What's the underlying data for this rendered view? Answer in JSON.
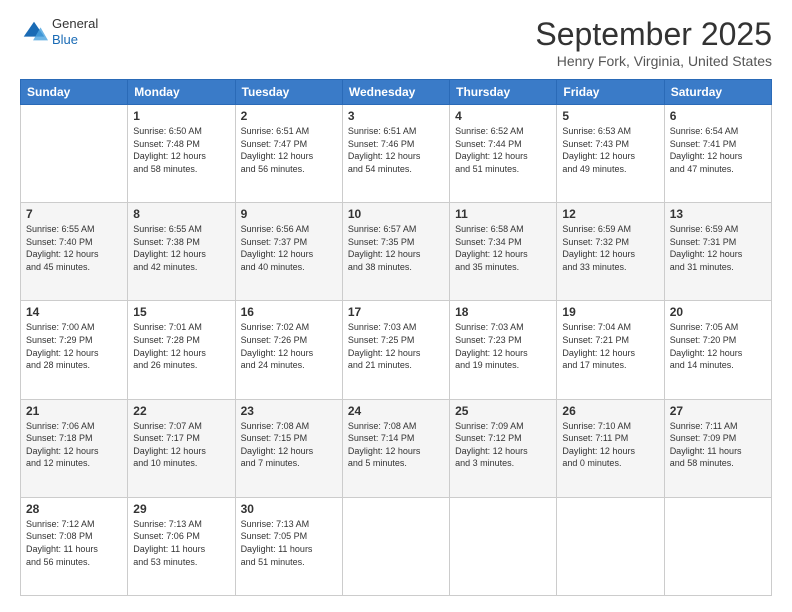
{
  "header": {
    "logo": {
      "general": "General",
      "blue": "Blue"
    },
    "title": "September 2025",
    "location": "Henry Fork, Virginia, United States"
  },
  "calendar": {
    "days_of_week": [
      "Sunday",
      "Monday",
      "Tuesday",
      "Wednesday",
      "Thursday",
      "Friday",
      "Saturday"
    ],
    "weeks": [
      [
        {
          "day": "",
          "content": ""
        },
        {
          "day": "1",
          "content": "Sunrise: 6:50 AM\nSunset: 7:48 PM\nDaylight: 12 hours\nand 58 minutes."
        },
        {
          "day": "2",
          "content": "Sunrise: 6:51 AM\nSunset: 7:47 PM\nDaylight: 12 hours\nand 56 minutes."
        },
        {
          "day": "3",
          "content": "Sunrise: 6:51 AM\nSunset: 7:46 PM\nDaylight: 12 hours\nand 54 minutes."
        },
        {
          "day": "4",
          "content": "Sunrise: 6:52 AM\nSunset: 7:44 PM\nDaylight: 12 hours\nand 51 minutes."
        },
        {
          "day": "5",
          "content": "Sunrise: 6:53 AM\nSunset: 7:43 PM\nDaylight: 12 hours\nand 49 minutes."
        },
        {
          "day": "6",
          "content": "Sunrise: 6:54 AM\nSunset: 7:41 PM\nDaylight: 12 hours\nand 47 minutes."
        }
      ],
      [
        {
          "day": "7",
          "content": "Sunrise: 6:55 AM\nSunset: 7:40 PM\nDaylight: 12 hours\nand 45 minutes."
        },
        {
          "day": "8",
          "content": "Sunrise: 6:55 AM\nSunset: 7:38 PM\nDaylight: 12 hours\nand 42 minutes."
        },
        {
          "day": "9",
          "content": "Sunrise: 6:56 AM\nSunset: 7:37 PM\nDaylight: 12 hours\nand 40 minutes."
        },
        {
          "day": "10",
          "content": "Sunrise: 6:57 AM\nSunset: 7:35 PM\nDaylight: 12 hours\nand 38 minutes."
        },
        {
          "day": "11",
          "content": "Sunrise: 6:58 AM\nSunset: 7:34 PM\nDaylight: 12 hours\nand 35 minutes."
        },
        {
          "day": "12",
          "content": "Sunrise: 6:59 AM\nSunset: 7:32 PM\nDaylight: 12 hours\nand 33 minutes."
        },
        {
          "day": "13",
          "content": "Sunrise: 6:59 AM\nSunset: 7:31 PM\nDaylight: 12 hours\nand 31 minutes."
        }
      ],
      [
        {
          "day": "14",
          "content": "Sunrise: 7:00 AM\nSunset: 7:29 PM\nDaylight: 12 hours\nand 28 minutes."
        },
        {
          "day": "15",
          "content": "Sunrise: 7:01 AM\nSunset: 7:28 PM\nDaylight: 12 hours\nand 26 minutes."
        },
        {
          "day": "16",
          "content": "Sunrise: 7:02 AM\nSunset: 7:26 PM\nDaylight: 12 hours\nand 24 minutes."
        },
        {
          "day": "17",
          "content": "Sunrise: 7:03 AM\nSunset: 7:25 PM\nDaylight: 12 hours\nand 21 minutes."
        },
        {
          "day": "18",
          "content": "Sunrise: 7:03 AM\nSunset: 7:23 PM\nDaylight: 12 hours\nand 19 minutes."
        },
        {
          "day": "19",
          "content": "Sunrise: 7:04 AM\nSunset: 7:21 PM\nDaylight: 12 hours\nand 17 minutes."
        },
        {
          "day": "20",
          "content": "Sunrise: 7:05 AM\nSunset: 7:20 PM\nDaylight: 12 hours\nand 14 minutes."
        }
      ],
      [
        {
          "day": "21",
          "content": "Sunrise: 7:06 AM\nSunset: 7:18 PM\nDaylight: 12 hours\nand 12 minutes."
        },
        {
          "day": "22",
          "content": "Sunrise: 7:07 AM\nSunset: 7:17 PM\nDaylight: 12 hours\nand 10 minutes."
        },
        {
          "day": "23",
          "content": "Sunrise: 7:08 AM\nSunset: 7:15 PM\nDaylight: 12 hours\nand 7 minutes."
        },
        {
          "day": "24",
          "content": "Sunrise: 7:08 AM\nSunset: 7:14 PM\nDaylight: 12 hours\nand 5 minutes."
        },
        {
          "day": "25",
          "content": "Sunrise: 7:09 AM\nSunset: 7:12 PM\nDaylight: 12 hours\nand 3 minutes."
        },
        {
          "day": "26",
          "content": "Sunrise: 7:10 AM\nSunset: 7:11 PM\nDaylight: 12 hours\nand 0 minutes."
        },
        {
          "day": "27",
          "content": "Sunrise: 7:11 AM\nSunset: 7:09 PM\nDaylight: 11 hours\nand 58 minutes."
        }
      ],
      [
        {
          "day": "28",
          "content": "Sunrise: 7:12 AM\nSunset: 7:08 PM\nDaylight: 11 hours\nand 56 minutes."
        },
        {
          "day": "29",
          "content": "Sunrise: 7:13 AM\nSunset: 7:06 PM\nDaylight: 11 hours\nand 53 minutes."
        },
        {
          "day": "30",
          "content": "Sunrise: 7:13 AM\nSunset: 7:05 PM\nDaylight: 11 hours\nand 51 minutes."
        },
        {
          "day": "",
          "content": ""
        },
        {
          "day": "",
          "content": ""
        },
        {
          "day": "",
          "content": ""
        },
        {
          "day": "",
          "content": ""
        }
      ]
    ]
  }
}
